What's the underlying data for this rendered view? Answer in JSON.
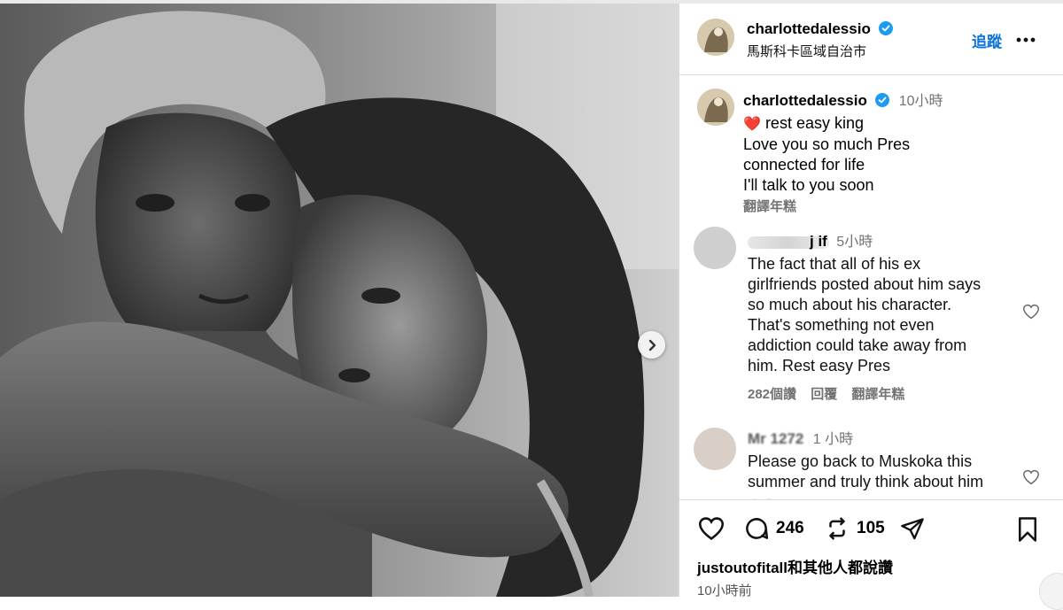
{
  "post": {
    "author": "charlottedalessio",
    "location": "馬斯科卡區域自治市",
    "follow_label": "追蹤",
    "caption": {
      "heart": "❤️",
      "line1": "rest easy king",
      "line2": "Love you so much Pres",
      "line3": "connected for life",
      "line4": "I'll talk to you soon",
      "time": "10小時",
      "translate": "翻譯年糕"
    }
  },
  "comments": [
    {
      "username": "j if",
      "time": "5小時",
      "text_lines": [
        "The fact that all of his ex",
        "girlfriends posted about him says",
        "so much about his character.",
        "That's something not even",
        "addiction could take away from",
        "him. Rest easy Pres"
      ],
      "likes": "282個讚",
      "reply": "回覆",
      "translate": "翻譯年糕"
    },
    {
      "username": "Mr 1272",
      "time": "1 小時",
      "text_lines": [
        "Please go back to Muskoka this",
        "summer and truly think about him"
      ]
    }
  ],
  "actions": {
    "comment_count": "246",
    "repost_count": "105"
  },
  "footer": {
    "liked_by": "justoutofitall和其他人都說讚",
    "time": "10小時前"
  },
  "icons": {
    "next": "chevron-right-icon",
    "verified": "verified-badge-icon",
    "more": "more-options-icon",
    "like": "heart-outline-icon",
    "comment": "comment-bubble-icon",
    "repost": "repost-icon",
    "share": "send-icon",
    "save": "bookmark-icon"
  },
  "colors": {
    "accent": "#0a73d9",
    "verified": "#1d9bf0",
    "heart": "#e0245e",
    "muted": "#737373"
  }
}
